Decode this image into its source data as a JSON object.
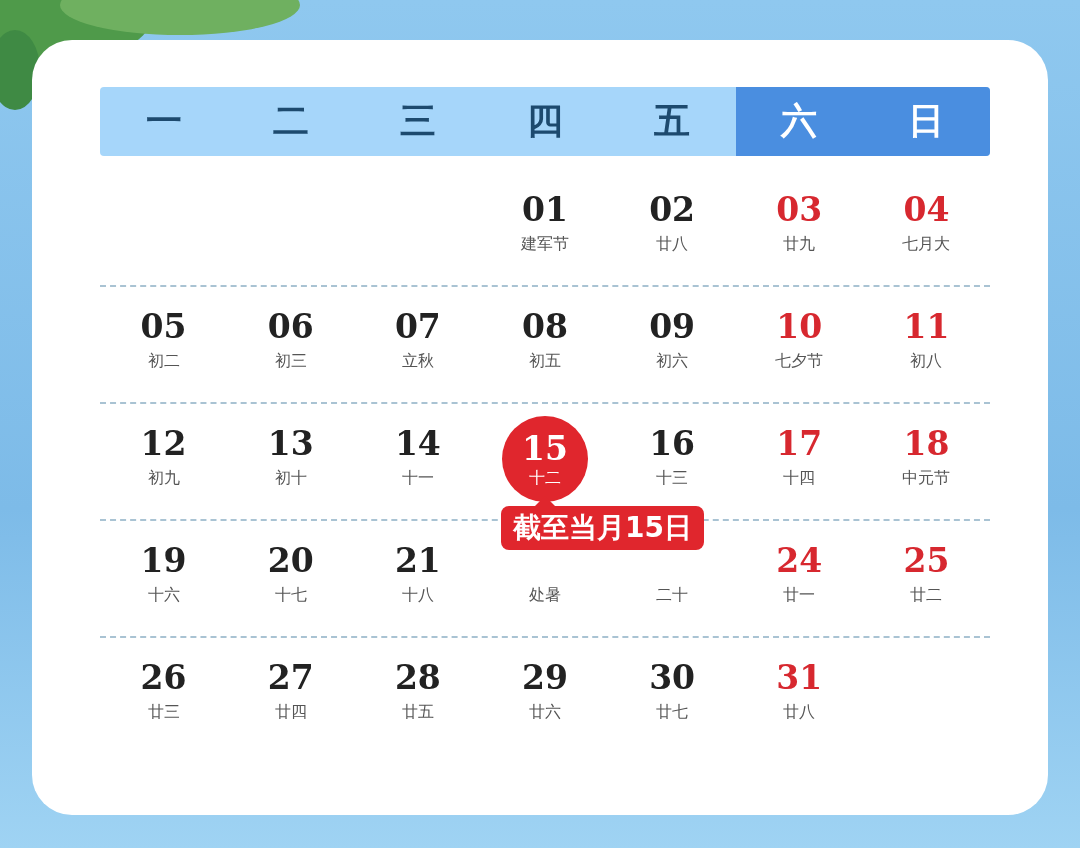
{
  "weekdays": [
    {
      "label": "一",
      "selected": false
    },
    {
      "label": "二",
      "selected": false
    },
    {
      "label": "三",
      "selected": false
    },
    {
      "label": "四",
      "selected": false
    },
    {
      "label": "五",
      "selected": false
    },
    {
      "label": "六",
      "selected": true
    },
    {
      "label": "日",
      "selected": true
    }
  ],
  "weeks": [
    [
      {
        "day": "01",
        "lunar": "建军节",
        "kind": "weekday",
        "selected": false
      },
      {
        "day": "02",
        "lunar": "廿八",
        "kind": "weekday",
        "selected": false
      },
      {
        "day": "03",
        "lunar": "廿九",
        "kind": "weekend",
        "selected": false
      },
      {
        "day": "04",
        "lunar": "七月大",
        "kind": "weekend",
        "selected": false
      }
    ],
    [
      {
        "day": "05",
        "lunar": "初二",
        "kind": "weekday",
        "selected": false
      },
      {
        "day": "06",
        "lunar": "初三",
        "kind": "weekday",
        "selected": false
      },
      {
        "day": "07",
        "lunar": "立秋",
        "kind": "weekday",
        "selected": false
      },
      {
        "day": "08",
        "lunar": "初五",
        "kind": "weekday",
        "selected": false
      },
      {
        "day": "09",
        "lunar": "初六",
        "kind": "weekday",
        "selected": false
      },
      {
        "day": "10",
        "lunar": "七夕节",
        "kind": "weekend",
        "selected": false
      },
      {
        "day": "11",
        "lunar": "初八",
        "kind": "weekend",
        "selected": false
      }
    ],
    [
      {
        "day": "12",
        "lunar": "初九",
        "kind": "weekday",
        "selected": false
      },
      {
        "day": "13",
        "lunar": "初十",
        "kind": "weekday",
        "selected": false
      },
      {
        "day": "14",
        "lunar": "十一",
        "kind": "weekday",
        "selected": false
      },
      {
        "day": "15",
        "lunar": "十二",
        "kind": "weekday",
        "selected": true,
        "tooltip": "截至当月15日"
      },
      {
        "day": "16",
        "lunar": "十三",
        "kind": "weekday",
        "selected": false
      },
      {
        "day": "17",
        "lunar": "十四",
        "kind": "weekend",
        "selected": false
      },
      {
        "day": "18",
        "lunar": "中元节",
        "kind": "weekend",
        "selected": false
      }
    ],
    [
      {
        "day": "19",
        "lunar": "十六",
        "kind": "weekday",
        "selected": false
      },
      {
        "day": "20",
        "lunar": "十七",
        "kind": "weekday",
        "selected": false
      },
      {
        "day": "21",
        "lunar": "十八",
        "kind": "weekday",
        "selected": false
      },
      {
        "lunar": "处暑",
        "kind": "weekday",
        "selected": false
      },
      {
        "lunar": "二十",
        "kind": "weekday",
        "selected": false
      },
      {
        "day": "24",
        "lunar": "廿一",
        "kind": "weekend",
        "selected": false
      },
      {
        "day": "25",
        "lunar": "廿二",
        "kind": "weekend",
        "selected": false
      }
    ],
    [
      {
        "day": "26",
        "lunar": "廿三",
        "kind": "weekday",
        "selected": false
      },
      {
        "day": "27",
        "lunar": "廿四",
        "kind": "weekday",
        "selected": false
      },
      {
        "day": "28",
        "lunar": "廿五",
        "kind": "weekday",
        "selected": false
      },
      {
        "day": "29",
        "lunar": "廿六",
        "kind": "weekday",
        "selected": false
      },
      {
        "day": "30",
        "lunar": "廿七",
        "kind": "weekday",
        "selected": false
      },
      {
        "day": "31",
        "lunar": "廿八",
        "kind": "weekend",
        "selected": false
      }
    ]
  ]
}
